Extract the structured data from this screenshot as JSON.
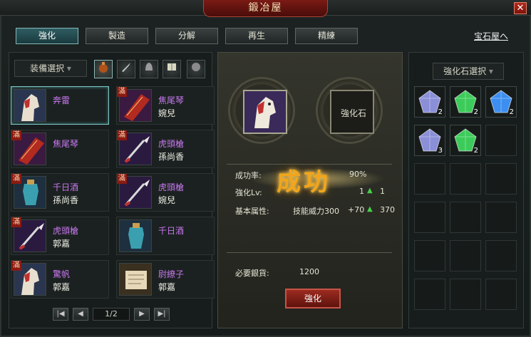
{
  "window": {
    "title": "鍛冶屋",
    "close_label": "✕"
  },
  "tabs": [
    {
      "label": "強化",
      "active": true
    },
    {
      "label": "製造",
      "active": false
    },
    {
      "label": "分解",
      "active": false
    },
    {
      "label": "再生",
      "active": false
    },
    {
      "label": "精練",
      "active": false
    }
  ],
  "gem_shop_link": "宝石屋へ",
  "left_panel": {
    "equip_select": "装備選択",
    "categories": [
      {
        "icon": "bag-icon",
        "active": true
      },
      {
        "icon": "sword-icon",
        "active": false
      },
      {
        "icon": "helmet-icon",
        "active": false
      },
      {
        "icon": "book-icon",
        "active": false
      },
      {
        "icon": "orb-icon",
        "active": false
      }
    ],
    "items": [
      {
        "name": "奔雷",
        "owner": "",
        "icon": "horse-icon",
        "full": false,
        "name_color": "purple",
        "selected": true
      },
      {
        "name": "焦尾琴",
        "owner": "婉兒",
        "icon": "zither-icon",
        "full": true,
        "name_color": "purple",
        "selected": false
      },
      {
        "name": "焦尾琴",
        "owner": "",
        "icon": "zither-icon",
        "full": true,
        "name_color": "purple",
        "selected": false
      },
      {
        "name": "虎頭槍",
        "owner": "孫尚香",
        "icon": "spear-icon",
        "full": true,
        "name_color": "purple",
        "selected": false
      },
      {
        "name": "千日酒",
        "owner": "孫尚香",
        "icon": "wine-icon",
        "full": true,
        "name_color": "purple",
        "selected": false
      },
      {
        "name": "虎頭槍",
        "owner": "婉兒",
        "icon": "spear-icon",
        "full": true,
        "name_color": "purple",
        "selected": false
      },
      {
        "name": "虎頭槍",
        "owner": "郭嘉",
        "icon": "spear-icon",
        "full": true,
        "name_color": "purple",
        "selected": false
      },
      {
        "name": "千日酒",
        "owner": "",
        "icon": "wine-icon",
        "full": false,
        "name_color": "purple",
        "selected": false
      },
      {
        "name": "驚帆",
        "owner": "郭嘉",
        "icon": "horse-icon",
        "full": true,
        "name_color": "purple",
        "selected": false
      },
      {
        "name": "尉繚子",
        "owner": "郭嘉",
        "icon": "scroll-icon",
        "full": false,
        "name_color": "purple",
        "selected": false
      }
    ],
    "pager": {
      "page": "1/2",
      "first": "|◀",
      "prev": "◀",
      "next": "▶",
      "last": "▶|"
    }
  },
  "middle_panel": {
    "stone_slot_label": "強化石",
    "success_text": "成功",
    "rate_label": "成功率:",
    "rate_value": "90%",
    "level_label": "強化Lv:",
    "level_from": "1",
    "level_to": "1",
    "attr_label": "基本属性:",
    "attr_name": "技能威力300",
    "attr_bonus": "+70",
    "attr_result": "370",
    "cost_label": "必要銀貨:",
    "cost_value": "1200",
    "enhance_button": "強化"
  },
  "right_panel": {
    "stone_select": "強化石選択",
    "gems": [
      {
        "color": "#8a8fd8",
        "count": "2",
        "icon": "purple-gem-icon"
      },
      {
        "color": "#3ccb5a",
        "count": "2",
        "icon": "green-gem-icon"
      },
      {
        "color": "#3c8ef0",
        "count": "2",
        "icon": "blue-gem-icon"
      },
      {
        "color": "#8a8fd8",
        "count": "3",
        "icon": "purple-gem-icon"
      },
      {
        "color": "#3ccb5a",
        "count": "2",
        "icon": "green-gem-icon"
      }
    ]
  }
}
